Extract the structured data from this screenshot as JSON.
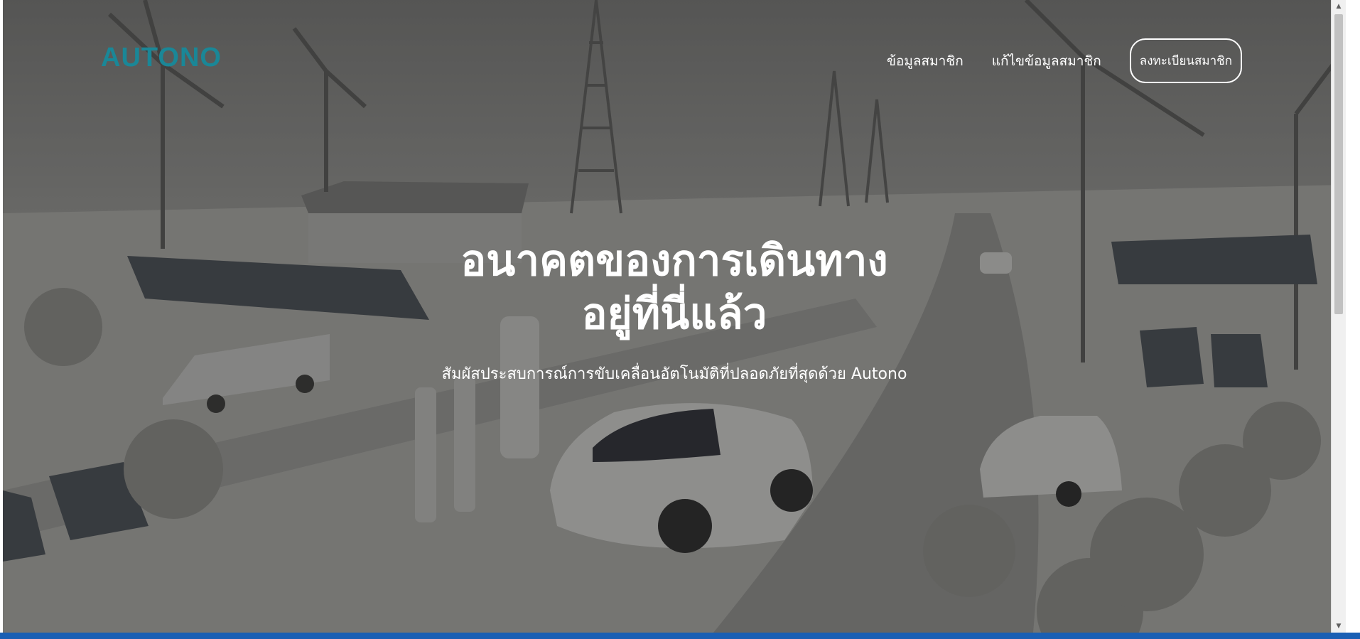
{
  "header": {
    "logo_text": "AUTONO",
    "logo_color": "#1a8797"
  },
  "nav": {
    "items": [
      {
        "label": "ข้อมูลสมาชิก"
      },
      {
        "label": "แก้ไขข้อมูลสมาชิก"
      }
    ],
    "register_label": "ลงทะเบียนสมาชิก"
  },
  "hero": {
    "title_line1": "อนาคตของการเดินทาง",
    "title_line2": "อยู่ที่นี่แล้ว",
    "subtitle": "สัมผัสประสบการณ์การขับเคลื่อนอัตโนมัติที่ปลอดภัยที่สุดด้วย Autono",
    "background_description_icon": "ev-charging-landscape-image",
    "overlay_color": "#000000"
  },
  "ui": {
    "scroll_up_icon": "triangle-up-icon",
    "scroll_down_icon": "triangle-down-icon",
    "scroll_up_glyph": "▲",
    "scroll_down_glyph": "▼",
    "taskbar_color": "#1a5fb4"
  }
}
